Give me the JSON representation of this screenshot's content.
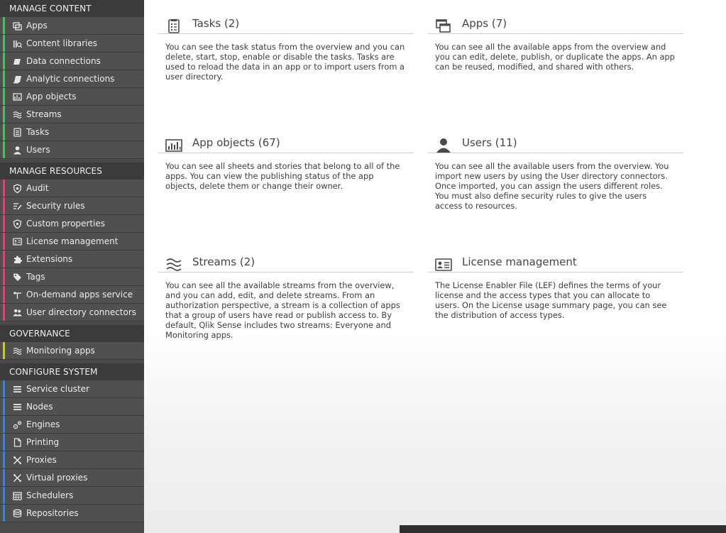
{
  "sidebar": {
    "groups": [
      {
        "header": "MANAGE CONTENT",
        "accent": "#5fb26d",
        "items": [
          {
            "label": "Apps",
            "icon": "apps-icon"
          },
          {
            "label": "Content libraries",
            "icon": "content-libraries-icon"
          },
          {
            "label": "Data connections",
            "icon": "data-connections-icon"
          },
          {
            "label": "Analytic connections",
            "icon": "analytic-connections-icon"
          },
          {
            "label": "App objects",
            "icon": "app-objects-icon"
          },
          {
            "label": "Streams",
            "icon": "streams-icon"
          },
          {
            "label": "Tasks",
            "icon": "tasks-icon"
          },
          {
            "label": "Users",
            "icon": "user-icon"
          }
        ]
      },
      {
        "header": "MANAGE RESOURCES",
        "accent": "#c64d74",
        "items": [
          {
            "label": "Audit",
            "icon": "shield-icon"
          },
          {
            "label": "Security rules",
            "icon": "security-rules-icon"
          },
          {
            "label": "Custom properties",
            "icon": "custom-properties-icon"
          },
          {
            "label": "License management",
            "icon": "license-icon"
          },
          {
            "label": "Extensions",
            "icon": "puzzle-icon"
          },
          {
            "label": "Tags",
            "icon": "tag-icon"
          },
          {
            "label": "On-demand apps service",
            "icon": "on-demand-icon"
          },
          {
            "label": "User directory connectors",
            "icon": "users-icon"
          }
        ]
      },
      {
        "header": "GOVERNANCE",
        "accent": "#c6c24a",
        "items": [
          {
            "label": "Monitoring apps",
            "icon": "streams-icon"
          }
        ]
      },
      {
        "header": "CONFIGURE SYSTEM",
        "accent": "#4c7fc0",
        "items": [
          {
            "label": "Service cluster",
            "icon": "list-icon"
          },
          {
            "label": "Nodes",
            "icon": "list-icon"
          },
          {
            "label": "Engines",
            "icon": "gears-icon"
          },
          {
            "label": "Printing",
            "icon": "document-icon"
          },
          {
            "label": "Proxies",
            "icon": "proxy-icon"
          },
          {
            "label": "Virtual proxies",
            "icon": "proxy-icon"
          },
          {
            "label": "Schedulers",
            "icon": "calendar-icon"
          },
          {
            "label": "Repositories",
            "icon": "database-icon"
          }
        ]
      }
    ]
  },
  "cards": [
    {
      "title": "Tasks (2)",
      "icon": "tasks-icon",
      "text": "You can see the task status from the overview and you can delete, start, stop, enable or disable the tasks. Tasks are used to reload the data in an app or to import users from a user directory."
    },
    {
      "title": "Apps (7)",
      "icon": "apps-icon",
      "text": "You can see all the available apps from the overview and you can edit, delete, publish, or duplicate the apps. An app can be reused, modified, and shared with others."
    },
    {
      "title": "App objects (67)",
      "icon": "app-objects-icon",
      "text": "You can see all sheets and stories that belong to all of the apps. You can view the publishing status of the app objects, delete them or change their owner."
    },
    {
      "title": "Users (11)",
      "icon": "user-icon",
      "text": "You can see all the available users from the overview. You import new users by using the User directory connectors. Once imported, you can assign the users different roles. You must also define security rules to give the users access to resources."
    },
    {
      "title": "Streams (2)",
      "icon": "streams-icon",
      "text": "You can see all the available streams from the overview, and you can add, edit, and delete streams. From an authorization perspective, a stream is a collection of apps that a group of users have read or publish access to. By default, Qlik Sense includes two streams: Everyone and Monitoring apps."
    },
    {
      "title": "License management",
      "icon": "license-icon",
      "text": "The License Enabler File (LEF) defines the terms of your license and the access types that you can allocate to users. On the License usage summary page, you can see the distribution of access types."
    }
  ]
}
